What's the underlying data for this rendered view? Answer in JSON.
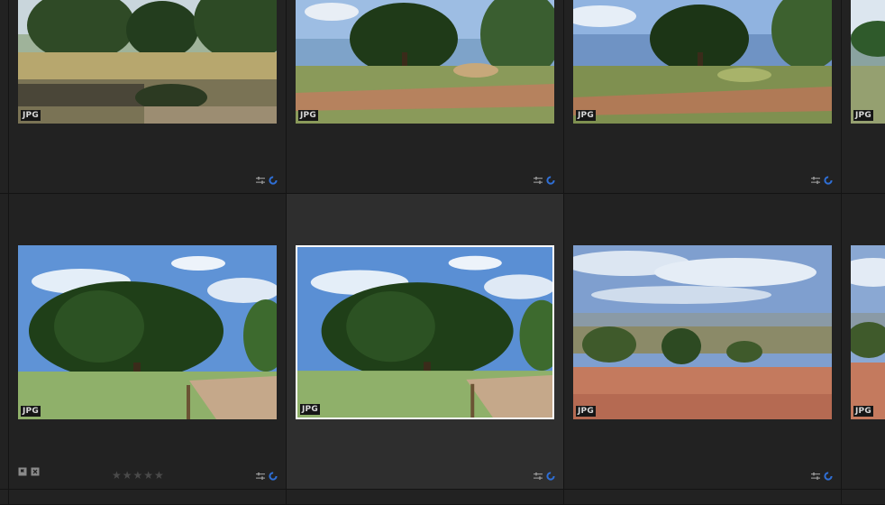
{
  "grid": {
    "cells": [
      {
        "name": "thumbnail-cell-1",
        "format": "JPG",
        "selected": false,
        "scene": "stone-wall"
      },
      {
        "name": "thumbnail-cell-2",
        "format": "JPG",
        "selected": false,
        "scene": "dirt-road-tree"
      },
      {
        "name": "thumbnail-cell-3",
        "format": "JPG",
        "selected": false,
        "scene": "dirt-road-tree-2"
      },
      {
        "name": "thumbnail-cell-4",
        "format": "JPG",
        "selected": false,
        "scene": "partial"
      },
      {
        "name": "thumbnail-cell-5",
        "format": "JPG",
        "selected": false,
        "scene": "big-tree",
        "rating_stars": "★★★★★",
        "rating": 0
      },
      {
        "name": "thumbnail-cell-6",
        "format": "JPG",
        "selected": true,
        "scene": "big-tree"
      },
      {
        "name": "thumbnail-cell-7",
        "format": "JPG",
        "selected": false,
        "scene": "valley"
      },
      {
        "name": "thumbnail-cell-8",
        "format": "JPG",
        "selected": false,
        "scene": "partial-2"
      }
    ]
  },
  "colors": {
    "background": "#1c1c1c",
    "cell": "#222222",
    "cell_selected": "#2e2e2e",
    "sync_spinner": "#2f6fd6",
    "icon_gray": "#8a8a8a"
  }
}
